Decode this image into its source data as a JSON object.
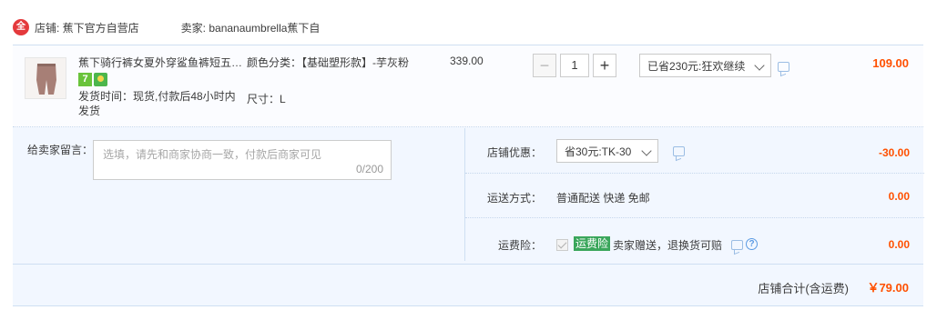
{
  "shop": {
    "logo_text": "全",
    "name_label": "店铺: 蕉下官方自营店",
    "seller_label": "卖家: bananaumbrella蕉下自"
  },
  "item": {
    "title": "蕉下骑行裤女夏外穿鲨鱼裤短五分裤",
    "badge_seven": "7",
    "ship_time": "发货时间：现货,付款后48小时内发货",
    "sku_color": "颜色分类：【基础塑形款】-芋灰粉",
    "sku_size": "尺寸：L",
    "unit_price": "339.00",
    "quantity": "1",
    "qty_minus": "−",
    "qty_plus": "+",
    "promo_selected": "已省230元:狂欢继续",
    "subtotal": "109.00"
  },
  "message": {
    "label": "给卖家留言：",
    "placeholder": "选填，请先和商家协商一致，付款后商家可见",
    "count": "0/200"
  },
  "shop_discount": {
    "label": "店铺优惠：",
    "selected": "省30元:TK-30",
    "amount": "-30.00"
  },
  "delivery": {
    "label": "运送方式：",
    "value": "普通配送 快递 免邮",
    "amount": "0.00"
  },
  "shipping_insurance": {
    "label": "运费险：",
    "tag": "运费险",
    "text": "卖家赠送，退换货可赔",
    "help": "?",
    "amount": "0.00"
  },
  "total": {
    "label": "店铺合计(含运费)",
    "amount": "￥79.00"
  },
  "colors": {
    "accent_orange": "#ff5000",
    "panel_blue": "#f2f7ff",
    "insurance_green": "#3aa65b"
  },
  "icons": [
    "shop-logo-icon",
    "chat-icon",
    "help-icon",
    "checkbox-icon",
    "chevron-down-icon"
  ]
}
